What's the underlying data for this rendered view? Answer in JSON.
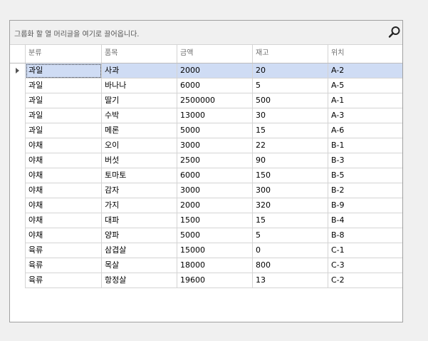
{
  "grid": {
    "group_panel_text": "그룹화 할 열 머리글을 여기로 끌어옵니다.",
    "search_icon": "search-icon",
    "columns": [
      "분류",
      "품목",
      "금액",
      "재고",
      "위치"
    ],
    "selected_row": 0,
    "rows": [
      [
        "과일",
        "사과",
        "2000",
        "20",
        "A-2"
      ],
      [
        "과일",
        "바나나",
        "6000",
        "5",
        "A-5"
      ],
      [
        "과일",
        "딸기",
        "2500000",
        "500",
        "A-1"
      ],
      [
        "과일",
        "수박",
        "13000",
        "30",
        "A-3"
      ],
      [
        "과일",
        "메론",
        "5000",
        "15",
        "A-6"
      ],
      [
        "야채",
        "오이",
        "3000",
        "22",
        "B-1"
      ],
      [
        "야채",
        "버섯",
        "2500",
        "90",
        "B-3"
      ],
      [
        "야채",
        "토마토",
        "6000",
        "150",
        "B-5"
      ],
      [
        "야채",
        "감자",
        "3000",
        "300",
        "B-2"
      ],
      [
        "야채",
        "가지",
        "2000",
        "320",
        "B-9"
      ],
      [
        "야채",
        "대파",
        "1500",
        "15",
        "B-4"
      ],
      [
        "야채",
        "양파",
        "5000",
        "5",
        "B-8"
      ],
      [
        "육류",
        "삼겹살",
        "15000",
        "0",
        "C-1"
      ],
      [
        "육류",
        "목살",
        "18000",
        "800",
        "C-3"
      ],
      [
        "육류",
        "항정살",
        "19600",
        "13",
        "C-2"
      ]
    ],
    "colors": {
      "selected_row": "#cfdcf4",
      "grid_line": "#d4d4d4",
      "border": "#a0a0a0"
    }
  }
}
